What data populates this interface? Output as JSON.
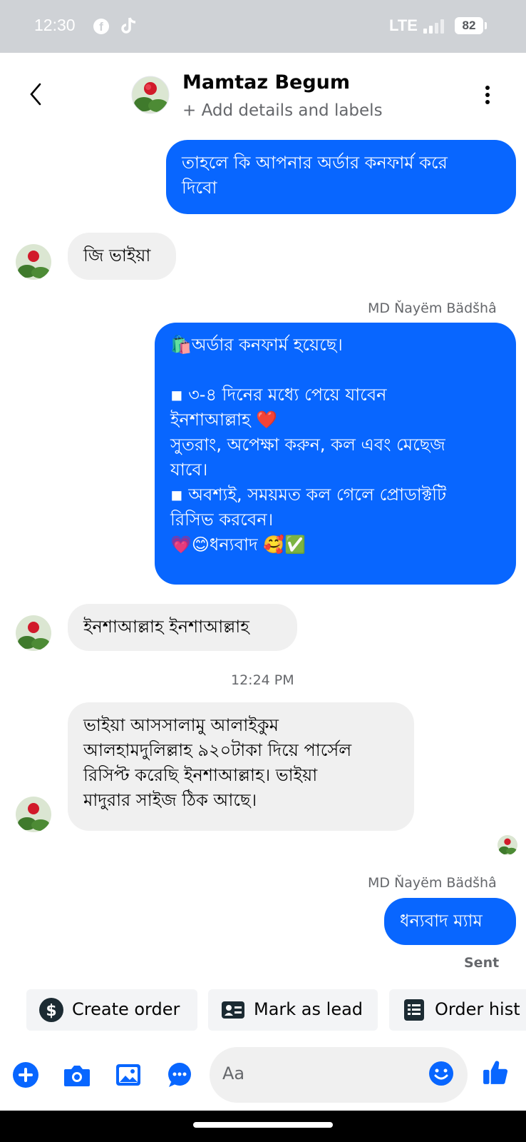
{
  "status_bar": {
    "time": "12:30",
    "network": "LTE",
    "battery": "82"
  },
  "header": {
    "contact_name": "Mamtaz Begum",
    "subtitle": "+ Add details and labels"
  },
  "messages": {
    "m1": {
      "lines": [
        "তাহলে কি আপনার অর্ডার কনফার্ম করে",
        "দিবো"
      ]
    },
    "m2": {
      "lines": [
        "জি ভাইয়া"
      ]
    },
    "m3_sender": "MD Ňayëm Bädšhâ",
    "m3": {
      "lines": [
        "🛍️অর্ডার কনফার্ম হয়েছে।",
        "",
        "◾ ৩-৪ দিনের মধ্যে পেয়ে যাবেন",
        "ইনশাআল্লাহ ❤️",
        "সুতরাং, অপেক্ষা করুন, কল এবং মেছেজ",
        "যাবে।",
        "◾ অবশ্যই, সময়মত কল গেলে প্রোডাক্টটি",
        "রিসিভ করবেন।",
        "💗😊ধন্যবাদ 🥰✅"
      ]
    },
    "m4": {
      "lines": [
        "ইনশাআল্লাহ ইনশাআল্লাহ"
      ]
    },
    "timestamp": "12:24 PM",
    "m5": {
      "lines": [
        "ভাইয়া আসসালামু আলাইকুম",
        "আলহামদুলিল্লাহ ৯২০টাকা দিয়ে পার্সেল",
        "রিসিপ্ট করেছি ইনশাআল্লাহ। ভাইয়া",
        "মাদুরার সাইজ ঠিক আছে।"
      ]
    },
    "m6_sender": "MD Ňayëm Bädšhâ",
    "m6": {
      "lines": [
        "ধন্যবাদ ম্যাম"
      ]
    },
    "m6_status": "Sent"
  },
  "quick_actions": {
    "create_order": "Create order",
    "mark_as_lead": "Mark as lead",
    "order_history": "Order hist"
  },
  "composer": {
    "placeholder": "Aa"
  },
  "colors": {
    "outgoing": "#0866ff",
    "incoming": "#f0f0f0",
    "accent": "#0866ff"
  }
}
